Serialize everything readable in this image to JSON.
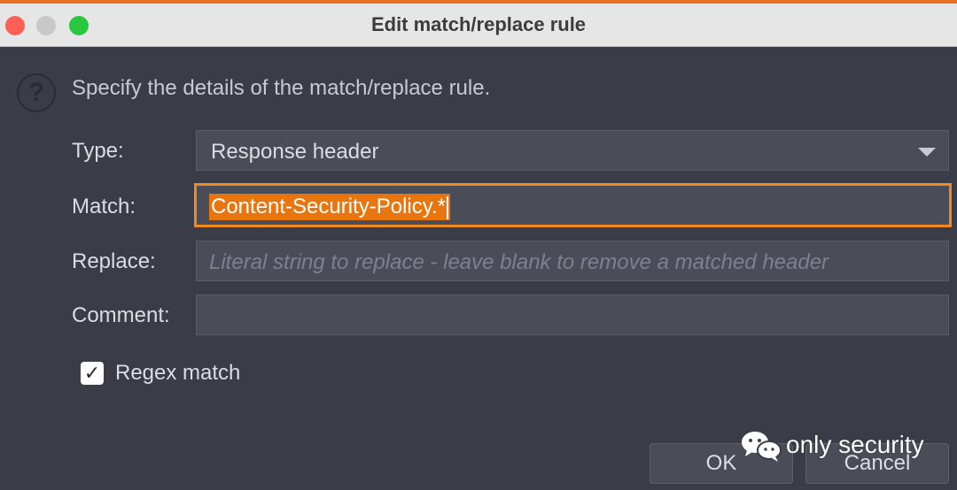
{
  "window": {
    "title": "Edit match/replace rule"
  },
  "dialog": {
    "instruction": "Specify the details of the match/replace rule.",
    "help_icon": "question-circle-icon",
    "type_label": "Type:",
    "type_value": "Response header",
    "match_label": "Match:",
    "match_value": "Content-Security-Policy.*",
    "replace_label": "Replace:",
    "replace_placeholder": "Literal string to replace - leave blank to remove a matched header",
    "comment_label": "Comment:",
    "comment_value": "",
    "regex_label": "Regex match",
    "regex_checked": true
  },
  "buttons": {
    "ok": "OK",
    "cancel": "Cancel"
  },
  "watermark": {
    "text": "only security",
    "icon": "wechat-icon"
  },
  "colors": {
    "accent": "#f08a1d",
    "selection": "#e8750e",
    "background": "#3a3c47",
    "field": "#4a4c58"
  }
}
